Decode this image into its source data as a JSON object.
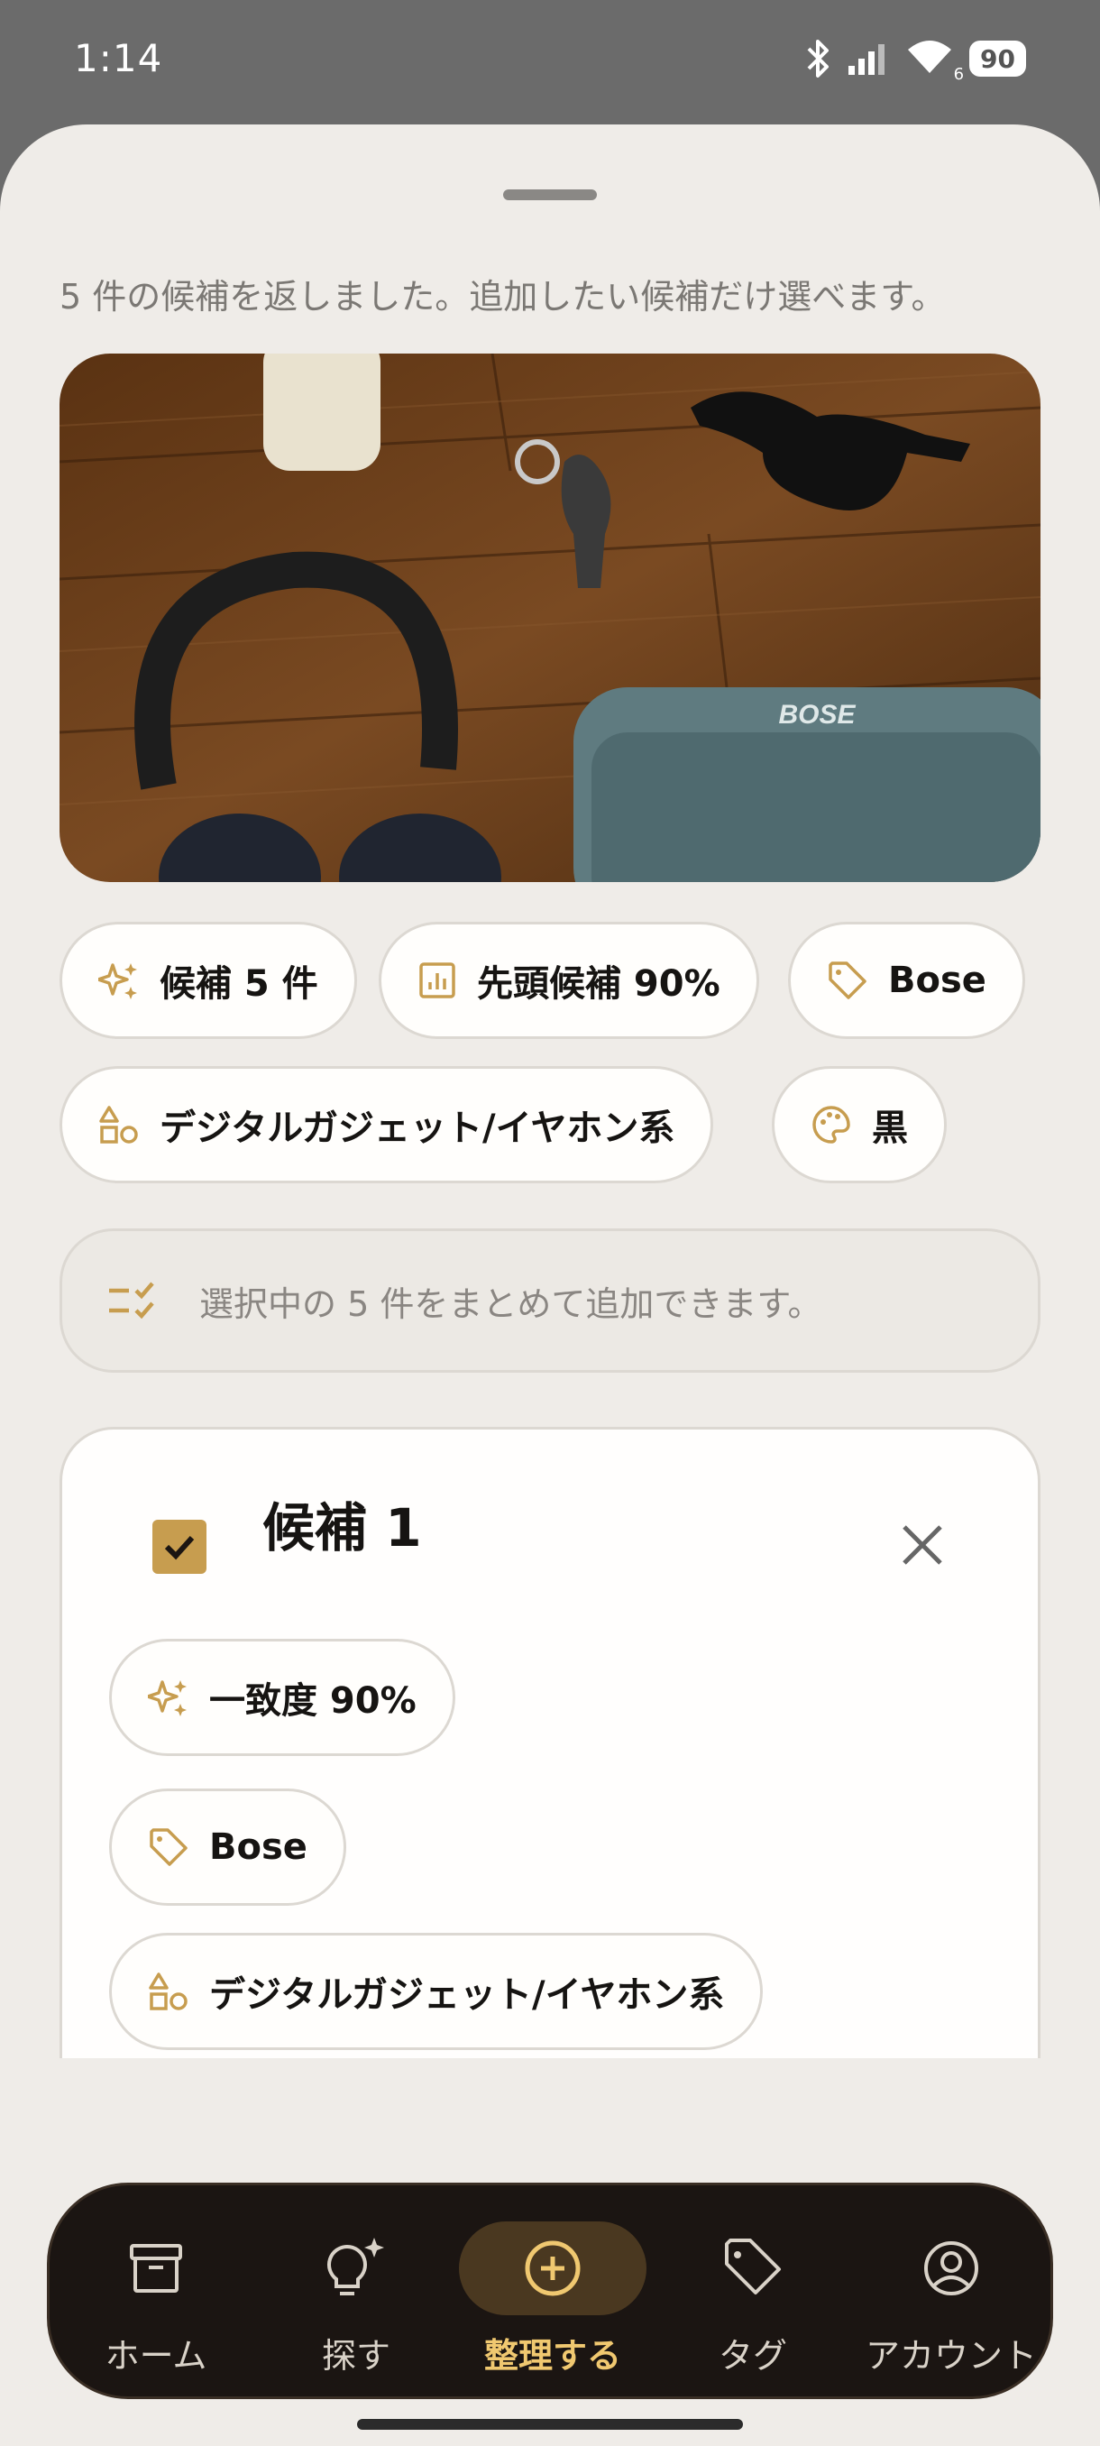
{
  "status_bar": {
    "time": "1:14",
    "battery": "90",
    "network_badge": "6"
  },
  "sheet": {
    "subtitle": "5 件の候補を返しました。追加したい候補だけ選べます。",
    "photo_logo": "BOSE",
    "summary_chips": {
      "candidates": "候補 5 件",
      "top_score": "先頭候補 90%",
      "brand": "Bose",
      "category": "デジタルガジェット/イヤホン系",
      "color": "黒"
    },
    "info_text": "選択中の 5 件をまとめて追加できます。"
  },
  "candidate_card": {
    "title": "候補 1",
    "checked": true,
    "chips": {
      "match": "一致度 90%",
      "brand": "Bose",
      "category": "デジタルガジェット/イヤホン系"
    }
  },
  "bottom_nav": {
    "items": [
      {
        "label": "ホーム",
        "icon": "archive-box-icon"
      },
      {
        "label": "探す",
        "icon": "lightbulb-sparkle-icon"
      },
      {
        "label": "整理する",
        "icon": "plus-circle-icon",
        "active": true
      },
      {
        "label": "タグ",
        "icon": "tag-icon"
      },
      {
        "label": "アカウント",
        "icon": "account-circle-icon"
      }
    ]
  },
  "colors": {
    "accent": "#c79d4f",
    "sheet_bg": "#efece8",
    "nav_bg": "#1b1512",
    "nav_active": "#f0c870"
  }
}
